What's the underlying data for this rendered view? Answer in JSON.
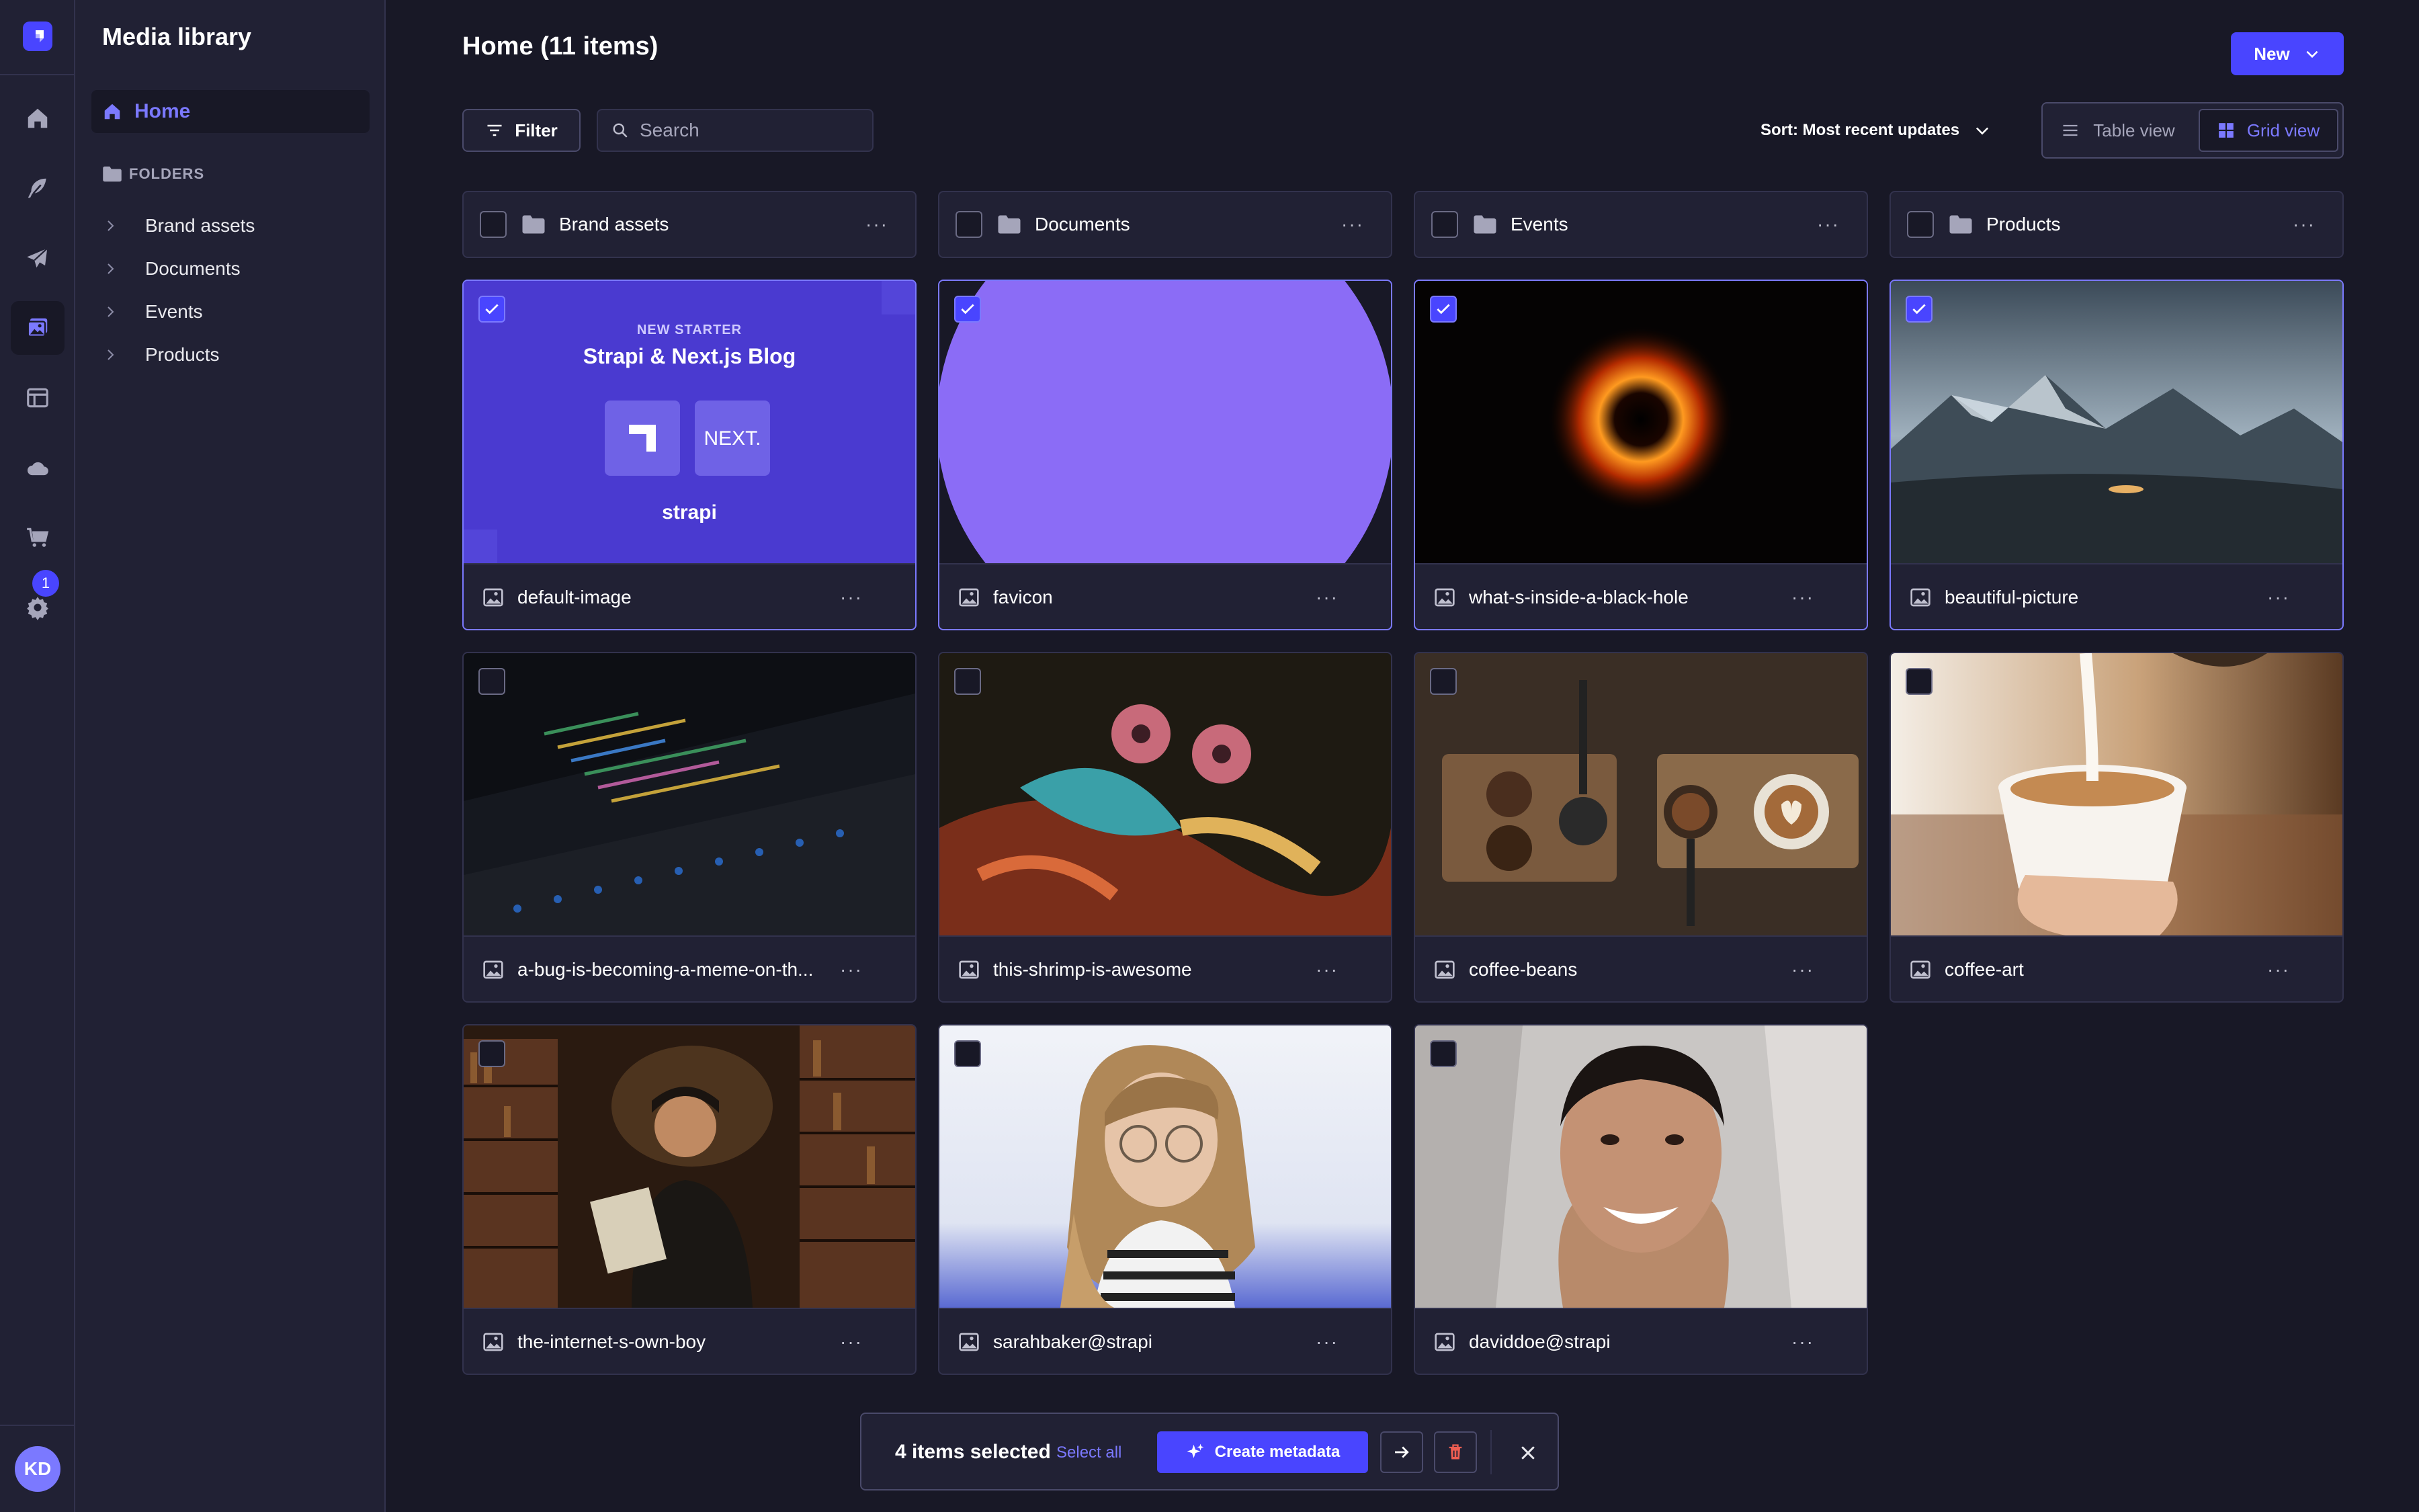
{
  "rail": {
    "avatar_initials": "KD",
    "settings_badge": "1",
    "icons": [
      "home-icon",
      "feather-icon",
      "paper-plane-icon",
      "media-library-icon",
      "layout-icon",
      "cloud-icon",
      "cart-icon",
      "gear-icon"
    ]
  },
  "subnav": {
    "title": "Media library",
    "home_label": "Home",
    "folders_header": "FOLDERS",
    "folders": [
      "Brand assets",
      "Documents",
      "Events",
      "Products"
    ]
  },
  "header": {
    "title": "Home (11 items)",
    "new_label": "New",
    "filter_label": "Filter",
    "search_placeholder": "Search",
    "sort_label": "Sort: Most recent updates",
    "table_view_label": "Table view",
    "grid_view_label": "Grid view"
  },
  "folder_cards": [
    {
      "name": "Brand assets"
    },
    {
      "name": "Documents"
    },
    {
      "name": "Events"
    },
    {
      "name": "Products"
    }
  ],
  "assets": [
    {
      "name": "default-image",
      "selected": true
    },
    {
      "name": "favicon",
      "selected": true
    },
    {
      "name": "what-s-inside-a-black-hole",
      "selected": true
    },
    {
      "name": "beautiful-picture",
      "selected": true
    },
    {
      "name": "a-bug-is-becoming-a-meme-on-th...",
      "selected": false
    },
    {
      "name": "this-shrimp-is-awesome",
      "selected": false
    },
    {
      "name": "coffee-beans",
      "selected": false
    },
    {
      "name": "coffee-art",
      "selected": false
    },
    {
      "name": "the-internet-s-own-boy",
      "selected": false
    },
    {
      "name": "sarahbaker@strapi",
      "selected": false
    },
    {
      "name": "daviddoe@strapi",
      "selected": false
    }
  ],
  "thumb_text": {
    "default_image_kicker": "NEW STARTER",
    "default_image_title": "Strapi & Next.js Blog",
    "default_image_next": "NEXT.",
    "default_image_brand": "strapi"
  },
  "actionbar": {
    "count_label": "4 items selected",
    "select_all_label": "Select all",
    "create_label": "Create metadata"
  },
  "colors": {
    "accent": "#4945ff",
    "accent_light": "#7b79ff",
    "background": "#181826",
    "panel": "#212134",
    "danger": "#ee5e52"
  }
}
